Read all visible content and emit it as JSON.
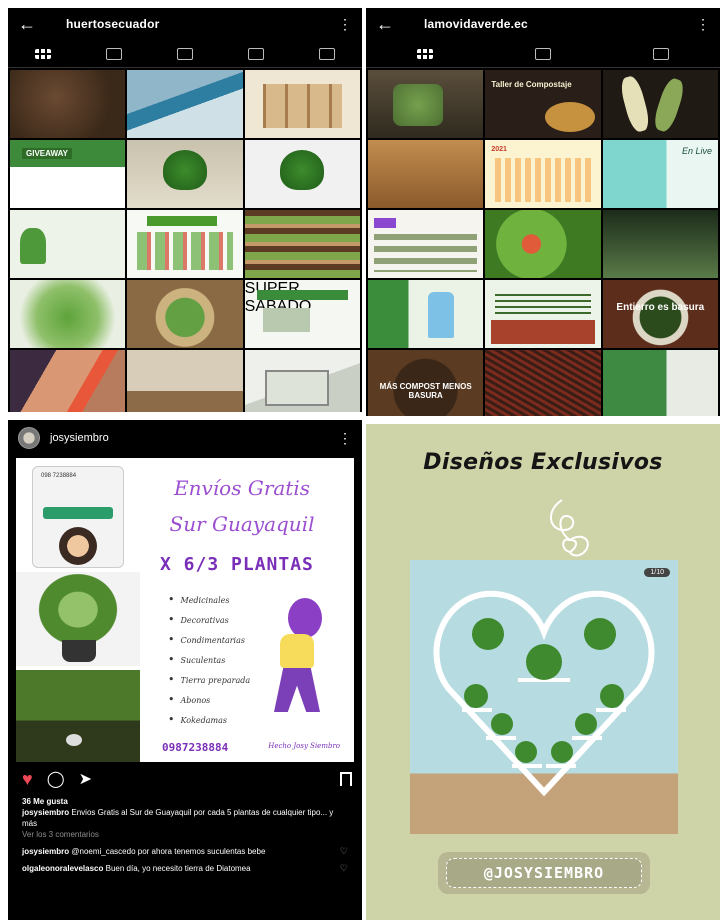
{
  "panel1": {
    "account": "huertosecuador",
    "back_icon": "arrow-left-icon",
    "menu_icon": "kebab-icon",
    "tabs": [
      "grid-icon",
      "reels-icon",
      "video-icon",
      "shop-icon",
      "tagged-icon"
    ],
    "tiles": [
      {
        "kind": "t-soil"
      },
      {
        "kind": "t-tank"
      },
      {
        "kind": "t-shelf"
      },
      {
        "kind": "t-green",
        "text": "GIVEAWAY"
      },
      {
        "kind": "t-plant"
      },
      {
        "kind": "t-wplant"
      },
      {
        "kind": "t-info"
      },
      {
        "kind": "t-chart"
      },
      {
        "kind": "t-store"
      },
      {
        "kind": "t-herb"
      },
      {
        "kind": "t-bowl"
      },
      {
        "kind": "t-flyer",
        "text": "SUPER SABADO"
      },
      {
        "kind": "t-hand"
      },
      {
        "kind": "t-room"
      },
      {
        "kind": "t-laptop"
      }
    ]
  },
  "panel2": {
    "account": "lamovidaverde.ec",
    "back_icon": "arrow-left-icon",
    "menu_icon": "kebab-icon",
    "tabs": [
      "grid-icon",
      "video-icon",
      "tagged-icon"
    ],
    "tiles": [
      {
        "kind": "u-glass"
      },
      {
        "kind": "u-taller",
        "text": "Taller de Compostaje"
      },
      {
        "kind": "u-corn"
      },
      {
        "kind": "u-wood"
      },
      {
        "kind": "u-cal",
        "text": "2021"
      },
      {
        "kind": "u-live",
        "text": "En Live"
      },
      {
        "kind": "u-list"
      },
      {
        "kind": "u-salad"
      },
      {
        "kind": "u-dark"
      },
      {
        "kind": "u-bottle"
      },
      {
        "kind": "u-text"
      },
      {
        "kind": "u-plate",
        "text": "Entierro es basura"
      },
      {
        "kind": "u-comp",
        "text": "MÁS COMPOST MENOS BASURA"
      },
      {
        "kind": "u-worms"
      },
      {
        "kind": "u-sheet"
      }
    ]
  },
  "panel3": {
    "account": "josysiembro",
    "menu_icon": "kebab-icon",
    "post": {
      "phone_number_small": "098 7238884",
      "line1": "Envíos Gratis",
      "line2": "Sur Guayaquil",
      "line3": "X 6/3 PLANTAS",
      "bullets": [
        "Medicinales",
        "Decorativas",
        "Condimentarias",
        "Suculentas",
        "Tierra preparada",
        "Abonos",
        "Kokedamas"
      ],
      "phone": "0987238884",
      "signature": "Hecho Josy Siembro"
    },
    "likes": "36 Me gusta",
    "caption_user": "josysiembro",
    "caption": "Envios Gratis al Sur de Guayaquil por cada 5 plantas de cualquier tipo... y más",
    "view_comments": "Ver los 3 comentarios",
    "comments": [
      {
        "user": "josysiembro",
        "text": "@noemi_cascedo por ahora tenemos suculentas bebe"
      },
      {
        "user": "olgaleonoralevelasco",
        "text": "Buen día, yo necesito tierra de Diatomea"
      }
    ]
  },
  "panel4": {
    "title": "Diseños Exclusivos",
    "counter": "1/10",
    "handle": "@JOSYSIEMBRO",
    "colors": {
      "background": "#cfd4a8",
      "handle": "#b7b793"
    }
  }
}
